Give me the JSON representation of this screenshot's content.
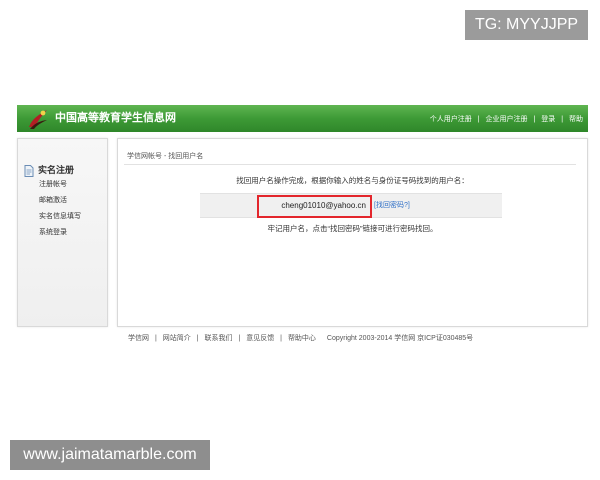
{
  "watermarks": {
    "top_right": "TG: MYYJJPP",
    "bottom_left": "www.jaimatamarble.com"
  },
  "header": {
    "logo_icon": "site-logo",
    "site_title": "中国高等教育学生信息网",
    "links": [
      "个人用户注册",
      "企业用户注册",
      "登录",
      "帮助"
    ],
    "separator": "|"
  },
  "sidebar": {
    "heading_icon": "document-icon",
    "heading": "实名注册",
    "items": [
      "注册帐号",
      "邮箱激活",
      "实名信息填写",
      "系统登录"
    ]
  },
  "main": {
    "breadcrumb": "学信网帐号 - 找回用户名",
    "result_message": "找回用户名操作完成，根据你输入的姓名与身份证号码找到的用户名：",
    "username": "cheng01010@yahoo.cn",
    "recover_password_link": "[找回密码?]",
    "hint": "牢记用户名，点击“找回密码”链接可进行密码找回。"
  },
  "footer": {
    "links": [
      "学信网",
      "网站简介",
      "联系我们",
      "意见反馈",
      "帮助中心"
    ],
    "separator": "|",
    "copyright": "Copyright 2003-2014 学信网 京ICP证030485号"
  },
  "colors": {
    "header_green": "#3d9a36",
    "link_blue": "#2f6fc6",
    "highlight_red": "#e3262c"
  }
}
